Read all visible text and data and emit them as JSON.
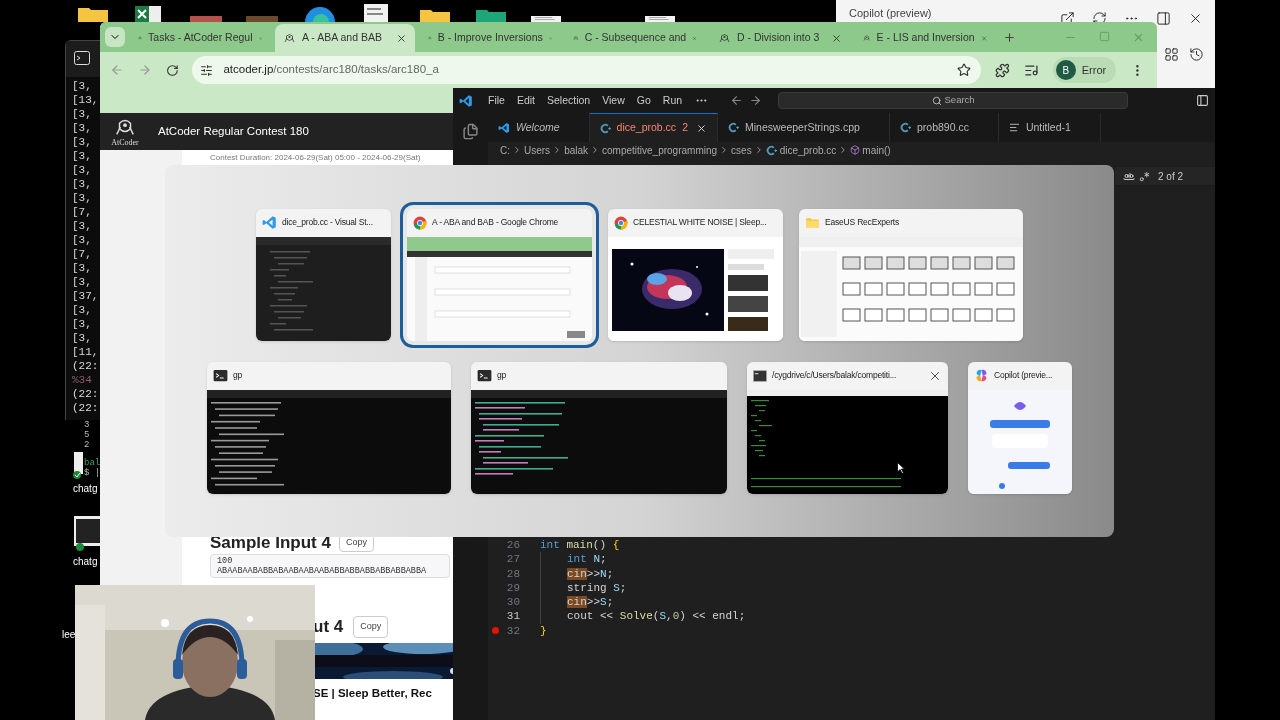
{
  "desktop": {
    "shortcut_labels": [
      "chatg",
      "chatg",
      "lee"
    ]
  },
  "console_window": {
    "lines": [
      "[3,",
      "[13,",
      "[3,",
      "[3,",
      "[3,",
      "[3,",
      "[3,",
      "[3,",
      "[3,",
      "[7,",
      "[3,",
      "[3,",
      "[7,",
      "[3,",
      "[3,",
      "[37,",
      "[3,",
      "[3,",
      "[3,",
      "[11,",
      "(22:",
      "%34",
      "(22:",
      "(22:"
    ]
  },
  "shell_window": {
    "lines": [
      "3",
      "5",
      "2"
    ],
    "prompt_user": "bal",
    "prompt": "$ |"
  },
  "copilot_panel": {
    "title": "Copilot (preview)"
  },
  "browser": {
    "tabs": [
      {
        "label": "Tasks - AtCoder Regul",
        "selected": false
      },
      {
        "label": "A - ABA and BAB",
        "selected": true
      },
      {
        "label": "B - Improve Inversions",
        "selected": false
      },
      {
        "label": "C - Subsequence and",
        "selected": false
      },
      {
        "label": "D - Division into 3",
        "selected": false
      },
      {
        "label": "E - LIS and Inversion",
        "selected": false
      }
    ],
    "url_host": "atcoder.jp",
    "url_path": "/contests/arc180/tasks/arc180_a",
    "profile_initial": "B",
    "profile_label": "Error",
    "site_logo_text": "AtCoder",
    "site_title": "AtCoder Regular Contest 180",
    "contest_duration": "Contest Duration: 2024-06-29(Sat) 05:00 - 2024-06-29(Sat)",
    "sample_input_heading": "Sample Input 4",
    "sample_input_copy": "Copy",
    "sample_input_lines": [
      "100",
      "ABAABAABABBABAABAABAABABBABBABBABBABBABBA"
    ],
    "sample_output_heading": "ut 4",
    "sample_output_copy": "Copy",
    "video_title": "SE | Sleep Better, Rec"
  },
  "editor": {
    "menu": [
      "File",
      "Edit",
      "Selection",
      "View",
      "Go",
      "Run"
    ],
    "search_placeholder": "Search",
    "tabs": [
      {
        "label": "Welcome",
        "kind": "welcome",
        "preview": true,
        "has_errors": false,
        "selected": false
      },
      {
        "label": "dice_prob.cc",
        "badge": "2",
        "kind": "cpp",
        "preview": false,
        "has_errors": true,
        "selected": true
      },
      {
        "label": "MinesweeperStrings.cpp",
        "kind": "cpp",
        "preview": false,
        "has_errors": false,
        "selected": false
      },
      {
        "label": "prob890.cc",
        "kind": "cpp",
        "preview": false,
        "has_errors": false,
        "selected": false
      },
      {
        "label": "Untitled-1",
        "kind": "text",
        "preview": false,
        "has_errors": false,
        "selected": false
      }
    ],
    "breadcrumb": [
      {
        "label": "C:",
        "kind": "folder"
      },
      {
        "label": "Users",
        "kind": "folder"
      },
      {
        "label": "balak",
        "kind": "folder"
      },
      {
        "label": "competitive_programming",
        "kind": "folder"
      },
      {
        "label": "cses",
        "kind": "folder"
      },
      {
        "label": "dice_prob.cc",
        "kind": "cpp"
      },
      {
        "label": "main()",
        "kind": "symbol"
      }
    ],
    "find_result": "2 of 2",
    "code": [
      {
        "number": "26",
        "current": false,
        "breakpoint": false,
        "indent": false,
        "tokens": [
          {
            "text": "int ",
            "kind": "keyword"
          },
          {
            "text": "main",
            "kind": "function"
          },
          {
            "text": "() ",
            "kind": "plain"
          },
          {
            "text": "{",
            "kind": "brace"
          }
        ]
      },
      {
        "number": "27",
        "current": false,
        "breakpoint": false,
        "indent": true,
        "tokens": [
          {
            "text": "int ",
            "kind": "keyword"
          },
          {
            "text": "N",
            "kind": "variable"
          },
          {
            "text": ";",
            "kind": "plain"
          }
        ]
      },
      {
        "number": "28",
        "current": false,
        "breakpoint": false,
        "indent": true,
        "tokens": [
          {
            "text": "cin",
            "kind": "match"
          },
          {
            "text": ">>",
            "kind": "plain"
          },
          {
            "text": "N",
            "kind": "variable"
          },
          {
            "text": ";",
            "kind": "plain"
          }
        ]
      },
      {
        "number": "29",
        "current": false,
        "breakpoint": false,
        "indent": true,
        "tokens": [
          {
            "text": "string ",
            "kind": "plain"
          },
          {
            "text": "S",
            "kind": "variable"
          },
          {
            "text": ";",
            "kind": "plain"
          }
        ]
      },
      {
        "number": "30",
        "current": false,
        "breakpoint": false,
        "indent": true,
        "tokens": [
          {
            "text": "cin",
            "kind": "match"
          },
          {
            "text": ">>",
            "kind": "plain"
          },
          {
            "text": "S",
            "kind": "variable"
          },
          {
            "text": ";",
            "kind": "plain"
          }
        ]
      },
      {
        "number": "31",
        "current": true,
        "breakpoint": false,
        "indent": true,
        "tokens": [
          {
            "text": "cout << ",
            "kind": "plain"
          },
          {
            "text": "Solve",
            "kind": "function"
          },
          {
            "text": "(",
            "kind": "plain"
          },
          {
            "text": "S",
            "kind": "variable"
          },
          {
            "text": ",",
            "kind": "plain"
          },
          {
            "text": "0",
            "kind": "number"
          },
          {
            "text": ") << endl;",
            "kind": "plain"
          }
        ]
      },
      {
        "number": "32",
        "current": false,
        "breakpoint": true,
        "indent": false,
        "tokens": [
          {
            "text": "}",
            "kind": "brace"
          }
        ]
      }
    ]
  },
  "task_switcher": {
    "items": [
      {
        "title": "dice_prob.cc - Visual St...",
        "kind": "editor",
        "selected": false,
        "closable": false
      },
      {
        "title": "A - ABA and BAB - Google Chrome",
        "kind": "browser",
        "selected": true,
        "closable": false
      },
      {
        "title": "CELESTIAL WHITE NOISE | Sleep...",
        "kind": "video",
        "selected": false,
        "closable": false
      },
      {
        "title": "EaseUS RecExperts",
        "kind": "files",
        "selected": false,
        "closable": false
      },
      {
        "title": "gp",
        "kind": "terminal",
        "selected": false,
        "closable": false
      },
      {
        "title": "gp",
        "kind": "terminal-color",
        "selected": false,
        "closable": false
      },
      {
        "title": "/cygdrive/c/Users/balak/competiti...",
        "kind": "console",
        "selected": false,
        "closable": true
      },
      {
        "title": "Copilot (previe...",
        "kind": "chat",
        "selected": false,
        "closable": false
      }
    ]
  }
}
